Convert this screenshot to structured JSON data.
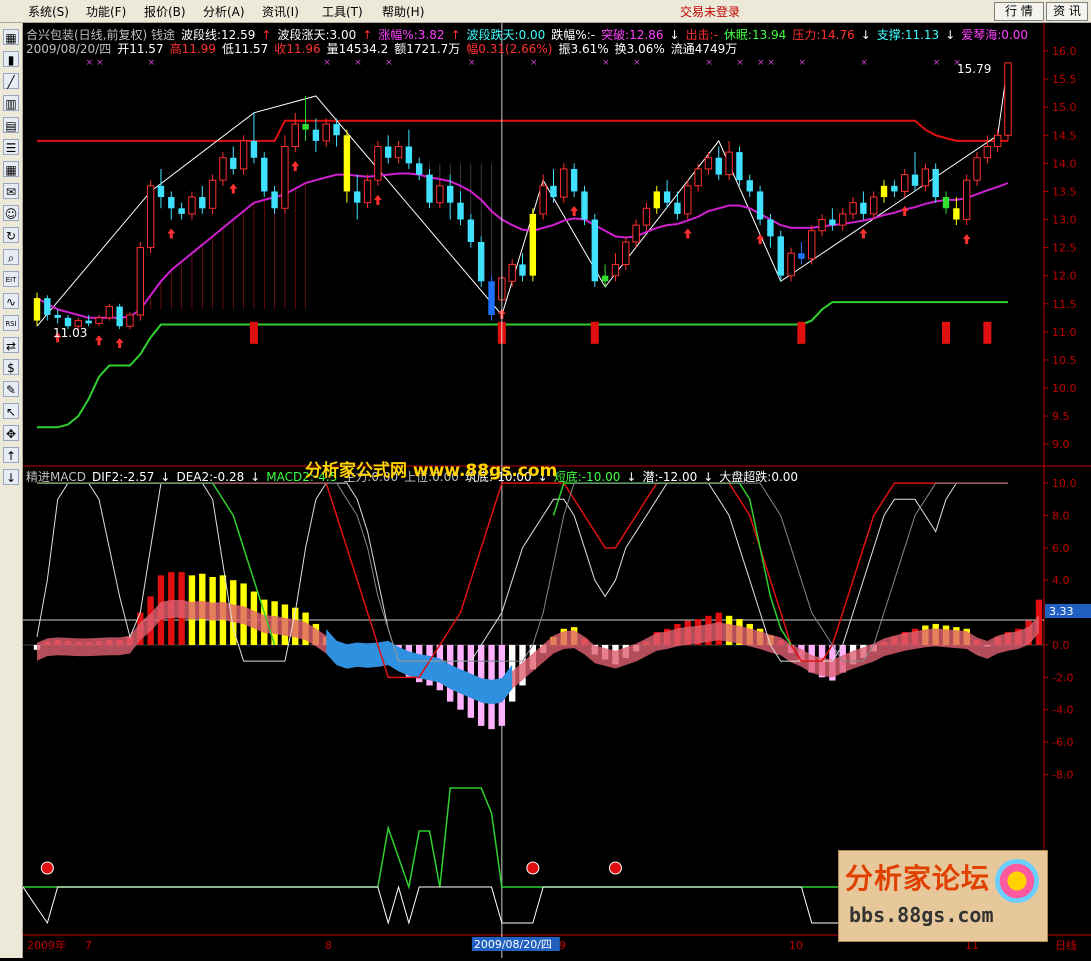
{
  "menu": {
    "items": [
      {
        "label": "系统(S)"
      },
      {
        "label": "功能(F)"
      },
      {
        "label": "报价(B)"
      },
      {
        "label": "分析(A)"
      },
      {
        "label": "资讯(I)"
      },
      {
        "label": "工具(T)"
      },
      {
        "label": "帮助(H)"
      }
    ],
    "status": "交易未登录",
    "quote_btn": "行 情",
    "info_btn": "资 讯"
  },
  "toolbar": {
    "icons": [
      "grid-icon",
      "candle-icon",
      "line-chart-icon",
      "bar-chart-icon",
      "window-icon",
      "list-icon",
      "table-icon",
      "mail-icon",
      "people-icon",
      "refresh-icon",
      "zoom-icon",
      "eft-icon",
      "wave-icon",
      "rsi-icon",
      "link-icon",
      "money-icon",
      "draw-icon",
      "pointer-icon",
      "move-icon",
      "arrow-up-icon",
      "arrow-down-icon"
    ],
    "labels": [
      "▦",
      "▮",
      "╱",
      "▥",
      "▤",
      "☰",
      "▦",
      "✉",
      "☺",
      "↻",
      "⌕",
      "EIT",
      "∿",
      "RSI",
      "⇄",
      "$",
      "✎",
      "↖",
      "✥",
      "↑",
      "↓"
    ]
  },
  "header": {
    "line1": [
      {
        "text": "合兴包装(日线,前复权) 钱途",
        "color": "#c0c0c0"
      },
      {
        "text": "波段线:12.59",
        "color": "#ffffff"
      },
      {
        "text": "↑",
        "color": "#ff3030"
      },
      {
        "text": "波段涨天:3.00",
        "color": "#ffffff"
      },
      {
        "text": "↑",
        "color": "#ff3030"
      },
      {
        "text": "涨幅%:3.82",
        "color": "#ff40ff"
      },
      {
        "text": "↑",
        "color": "#ff3030"
      },
      {
        "text": "波段跌天:0.00",
        "color": "#40ffff"
      },
      {
        "text": "跌幅%:-",
        "color": "#ffffff"
      },
      {
        "text": "突破:12.86",
        "color": "#ff40ff"
      },
      {
        "text": "↓",
        "color": "#ffffff"
      },
      {
        "text": "出击:-",
        "color": "#ff3030"
      },
      {
        "text": "休眠:13.94",
        "color": "#40ff40"
      },
      {
        "text": "压力:14.76",
        "color": "#ff3030"
      },
      {
        "text": "↓",
        "color": "#ffffff"
      },
      {
        "text": "支撑:11.13",
        "color": "#40ffff"
      },
      {
        "text": "↓",
        "color": "#ffffff"
      },
      {
        "text": "爱琴海:0.00",
        "color": "#ff40ff"
      }
    ],
    "line2": [
      {
        "text": "2009/08/20/四",
        "color": "#c0c0c0"
      },
      {
        "text": "开11.57",
        "color": "#ffffff"
      },
      {
        "text": "高11.99",
        "color": "#ff3030"
      },
      {
        "text": "低11.57",
        "color": "#ffffff"
      },
      {
        "text": "收11.96",
        "color": "#ff3030"
      },
      {
        "text": "量14534.2",
        "color": "#ffffff"
      },
      {
        "text": "额1721.7万",
        "color": "#ffffff"
      },
      {
        "text": "幅0.31(2.66%)",
        "color": "#ff3030"
      },
      {
        "text": "振3.61%",
        "color": "#ffffff"
      },
      {
        "text": "换3.06%",
        "color": "#ffffff"
      },
      {
        "text": "流通4749万",
        "color": "#ffffff"
      }
    ],
    "sub": [
      {
        "text": "精进MACD",
        "color": "#c0c0c0"
      },
      {
        "text": "DIF2:-2.57",
        "color": "#ffffff"
      },
      {
        "text": "↓",
        "color": "#ffffff"
      },
      {
        "text": "DEA2:-0.28",
        "color": "#ffffff"
      },
      {
        "text": "↓",
        "color": "#ffffff"
      },
      {
        "text": "MACD2:-4.5",
        "color": "#40ff40"
      },
      {
        "text": "主力:0.00",
        "color": "#c0c0c0"
      },
      {
        "text": "上位:0.00",
        "color": "#c0c0c0"
      },
      {
        "text": "筑底:-10.00",
        "color": "#ffffff"
      },
      {
        "text": "↓",
        "color": "#ffffff"
      },
      {
        "text": "短底:-10.00",
        "color": "#40ff40"
      },
      {
        "text": "↓",
        "color": "#ffffff"
      },
      {
        "text": "潜:-12.00",
        "color": "#ffffff"
      },
      {
        "text": "↓",
        "color": "#ffffff"
      },
      {
        "text": "大盘超跌:0.00",
        "color": "#ffffff"
      }
    ]
  },
  "watermark": "分析家公式网 www.88gs.com",
  "forum": {
    "title": "分析家论坛",
    "url": "bbs.88gs.com"
  },
  "price_labels": {
    "high": "15.79",
    "low": "11.03"
  },
  "crosshair_value": "3.33",
  "bottom_axis": {
    "year": "2009年",
    "m7": "7",
    "m8": "8",
    "cursor_date": "2009/08/20/四",
    "m9": "9",
    "m10": "10",
    "m11": "11",
    "period": "日线"
  },
  "chart_data": {
    "type": "candlestick",
    "price_axis": {
      "ticks": [
        16.0,
        15.5,
        15.0,
        14.5,
        14.0,
        13.5,
        13.0,
        12.5,
        12.0,
        11.5,
        11.0,
        10.5,
        10.0,
        9.5,
        9.0
      ],
      "min": 8.7,
      "max": 16.25
    },
    "macd_axis": {
      "ticks": [
        10.0,
        8.0,
        6.0,
        4.0,
        2.0,
        0.0,
        -2.0,
        -4.0,
        -6.0,
        -8.0
      ],
      "min": -11,
      "max": 10.5
    },
    "candles": [
      {
        "o": 11.2,
        "c": 11.6,
        "h": 11.7,
        "l": 11.1
      },
      {
        "o": 11.6,
        "c": 11.3,
        "h": 11.65,
        "l": 11.2
      },
      {
        "o": 11.3,
        "c": 11.25,
        "h": 11.4,
        "l": 11.15
      },
      {
        "o": 11.25,
        "c": 11.1,
        "h": 11.3,
        "l": 11.05
      },
      {
        "o": 11.1,
        "c": 11.2,
        "h": 11.25,
        "l": 11.03
      },
      {
        "o": 11.2,
        "c": 11.15,
        "h": 11.3,
        "l": 11.1
      },
      {
        "o": 11.15,
        "c": 11.25,
        "h": 11.3,
        "l": 11.1
      },
      {
        "o": 11.25,
        "c": 11.45,
        "h": 11.5,
        "l": 11.2
      },
      {
        "o": 11.45,
        "c": 11.1,
        "h": 11.5,
        "l": 11.05
      },
      {
        "o": 11.1,
        "c": 11.3,
        "h": 11.35,
        "l": 11.05
      },
      {
        "o": 11.3,
        "c": 12.5,
        "h": 12.6,
        "l": 11.2
      },
      {
        "o": 12.5,
        "c": 13.6,
        "h": 13.7,
        "l": 12.4
      },
      {
        "o": 13.6,
        "c": 13.4,
        "h": 13.9,
        "l": 13.2
      },
      {
        "o": 13.4,
        "c": 13.2,
        "h": 13.5,
        "l": 13.0
      },
      {
        "o": 13.2,
        "c": 13.1,
        "h": 13.3,
        "l": 13.0
      },
      {
        "o": 13.1,
        "c": 13.4,
        "h": 13.5,
        "l": 13.0
      },
      {
        "o": 13.4,
        "c": 13.2,
        "h": 13.6,
        "l": 13.1
      },
      {
        "o": 13.2,
        "c": 13.7,
        "h": 13.8,
        "l": 13.1
      },
      {
        "o": 13.7,
        "c": 14.1,
        "h": 14.2,
        "l": 13.6
      },
      {
        "o": 14.1,
        "c": 13.9,
        "h": 14.3,
        "l": 13.8
      },
      {
        "o": 13.9,
        "c": 14.4,
        "h": 14.5,
        "l": 13.8
      },
      {
        "o": 14.4,
        "c": 14.1,
        "h": 14.9,
        "l": 14.0
      },
      {
        "o": 14.1,
        "c": 13.5,
        "h": 14.2,
        "l": 13.4
      },
      {
        "o": 13.5,
        "c": 13.2,
        "h": 13.6,
        "l": 13.1
      },
      {
        "o": 13.2,
        "c": 14.3,
        "h": 14.5,
        "l": 13.1
      },
      {
        "o": 14.3,
        "c": 14.7,
        "h": 14.9,
        "l": 14.2
      },
      {
        "o": 14.7,
        "c": 14.6,
        "h": 15.2,
        "l": 14.4
      },
      {
        "o": 14.6,
        "c": 14.4,
        "h": 14.8,
        "l": 14.2
      },
      {
        "o": 14.4,
        "c": 14.7,
        "h": 14.8,
        "l": 14.3
      },
      {
        "o": 14.7,
        "c": 14.5,
        "h": 14.8,
        "l": 14.3
      },
      {
        "o": 14.5,
        "c": 13.5,
        "h": 14.6,
        "l": 13.3
      },
      {
        "o": 13.5,
        "c": 13.3,
        "h": 13.8,
        "l": 13.0
      },
      {
        "o": 13.3,
        "c": 13.7,
        "h": 13.8,
        "l": 13.2
      },
      {
        "o": 13.7,
        "c": 14.3,
        "h": 14.4,
        "l": 13.6
      },
      {
        "o": 14.3,
        "c": 14.1,
        "h": 14.5,
        "l": 14.0
      },
      {
        "o": 14.1,
        "c": 14.3,
        "h": 14.4,
        "l": 14.0
      },
      {
        "o": 14.3,
        "c": 14.0,
        "h": 14.6,
        "l": 13.9
      },
      {
        "o": 14.0,
        "c": 13.8,
        "h": 14.1,
        "l": 13.7
      },
      {
        "o": 13.8,
        "c": 13.3,
        "h": 13.9,
        "l": 13.2
      },
      {
        "o": 13.3,
        "c": 13.6,
        "h": 13.7,
        "l": 13.2
      },
      {
        "o": 13.6,
        "c": 13.3,
        "h": 13.8,
        "l": 13.0
      },
      {
        "o": 13.3,
        "c": 13.0,
        "h": 13.5,
        "l": 12.9
      },
      {
        "o": 13.0,
        "c": 12.6,
        "h": 13.1,
        "l": 12.5
      },
      {
        "o": 12.6,
        "c": 11.9,
        "h": 12.7,
        "l": 11.8
      },
      {
        "o": 11.9,
        "c": 11.3,
        "h": 12.0,
        "l": 11.2
      },
      {
        "o": 11.57,
        "c": 11.96,
        "h": 11.99,
        "l": 11.57
      },
      {
        "o": 11.9,
        "c": 12.2,
        "h": 12.3,
        "l": 11.8
      },
      {
        "o": 12.2,
        "c": 12.0,
        "h": 12.4,
        "l": 11.9
      },
      {
        "o": 12.0,
        "c": 13.1,
        "h": 13.2,
        "l": 11.9
      },
      {
        "o": 13.1,
        "c": 13.6,
        "h": 13.8,
        "l": 13.0
      },
      {
        "o": 13.6,
        "c": 13.4,
        "h": 13.9,
        "l": 13.3
      },
      {
        "o": 13.4,
        "c": 13.9,
        "h": 14.0,
        "l": 13.3
      },
      {
        "o": 13.9,
        "c": 13.5,
        "h": 14.0,
        "l": 13.4
      },
      {
        "o": 13.5,
        "c": 13.0,
        "h": 13.6,
        "l": 12.9
      },
      {
        "o": 13.0,
        "c": 11.9,
        "h": 13.1,
        "l": 11.8
      },
      {
        "o": 11.9,
        "c": 12.0,
        "h": 12.2,
        "l": 11.8
      },
      {
        "o": 12.0,
        "c": 12.2,
        "h": 12.4,
        "l": 11.9
      },
      {
        "o": 12.2,
        "c": 12.6,
        "h": 12.7,
        "l": 12.1
      },
      {
        "o": 12.6,
        "c": 12.9,
        "h": 13.0,
        "l": 12.5
      },
      {
        "o": 12.9,
        "c": 13.2,
        "h": 13.3,
        "l": 12.8
      },
      {
        "o": 13.2,
        "c": 13.5,
        "h": 13.6,
        "l": 13.1
      },
      {
        "o": 13.5,
        "c": 13.3,
        "h": 13.7,
        "l": 13.2
      },
      {
        "o": 13.3,
        "c": 13.1,
        "h": 13.5,
        "l": 13.0
      },
      {
        "o": 13.1,
        "c": 13.6,
        "h": 13.7,
        "l": 13.0
      },
      {
        "o": 13.6,
        "c": 13.9,
        "h": 14.0,
        "l": 13.5
      },
      {
        "o": 13.9,
        "c": 14.1,
        "h": 14.2,
        "l": 13.8
      },
      {
        "o": 14.1,
        "c": 13.8,
        "h": 14.3,
        "l": 13.7
      },
      {
        "o": 13.8,
        "c": 14.2,
        "h": 14.4,
        "l": 13.7
      },
      {
        "o": 14.2,
        "c": 13.7,
        "h": 14.3,
        "l": 13.6
      },
      {
        "o": 13.7,
        "c": 13.5,
        "h": 13.8,
        "l": 13.4
      },
      {
        "o": 13.5,
        "c": 13.0,
        "h": 13.6,
        "l": 12.9
      },
      {
        "o": 13.0,
        "c": 12.7,
        "h": 13.1,
        "l": 12.5
      },
      {
        "o": 12.7,
        "c": 12.0,
        "h": 12.8,
        "l": 11.9
      },
      {
        "o": 12.0,
        "c": 12.4,
        "h": 12.5,
        "l": 11.9
      },
      {
        "o": 12.4,
        "c": 12.3,
        "h": 12.6,
        "l": 12.2
      },
      {
        "o": 12.3,
        "c": 12.8,
        "h": 12.9,
        "l": 12.2
      },
      {
        "o": 12.8,
        "c": 13.0,
        "h": 13.1,
        "l": 12.7
      },
      {
        "o": 13.0,
        "c": 12.9,
        "h": 13.2,
        "l": 12.8
      },
      {
        "o": 12.9,
        "c": 13.1,
        "h": 13.2,
        "l": 12.8
      },
      {
        "o": 13.1,
        "c": 13.3,
        "h": 13.4,
        "l": 13.0
      },
      {
        "o": 13.3,
        "c": 13.1,
        "h": 13.5,
        "l": 13.0
      },
      {
        "o": 13.1,
        "c": 13.4,
        "h": 13.5,
        "l": 13.0
      },
      {
        "o": 13.4,
        "c": 13.6,
        "h": 13.7,
        "l": 13.3
      },
      {
        "o": 13.6,
        "c": 13.5,
        "h": 13.7,
        "l": 13.4
      },
      {
        "o": 13.5,
        "c": 13.8,
        "h": 13.9,
        "l": 13.4
      },
      {
        "o": 13.8,
        "c": 13.6,
        "h": 14.2,
        "l": 13.5
      },
      {
        "o": 13.6,
        "c": 13.9,
        "h": 14.0,
        "l": 13.5
      },
      {
        "o": 13.9,
        "c": 13.4,
        "h": 14.0,
        "l": 13.3
      },
      {
        "o": 13.4,
        "c": 13.2,
        "h": 13.5,
        "l": 13.1
      },
      {
        "o": 13.2,
        "c": 13.0,
        "h": 13.4,
        "l": 12.9
      },
      {
        "o": 13.0,
        "c": 13.7,
        "h": 13.8,
        "l": 12.9
      },
      {
        "o": 13.7,
        "c": 14.1,
        "h": 14.2,
        "l": 13.6
      },
      {
        "o": 14.1,
        "c": 14.3,
        "h": 14.5,
        "l": 14.0
      },
      {
        "o": 14.3,
        "c": 14.5,
        "h": 14.6,
        "l": 14.2
      },
      {
        "o": 14.5,
        "c": 15.79,
        "h": 15.79,
        "l": 14.4
      }
    ],
    "ma": [
      11.6,
      11.5,
      11.4,
      11.35,
      11.3,
      11.25,
      11.25,
      11.25,
      11.25,
      11.27,
      11.4,
      11.65,
      11.9,
      12.1,
      12.25,
      12.4,
      12.55,
      12.7,
      12.85,
      13.0,
      13.15,
      13.3,
      13.35,
      13.4,
      13.45,
      13.55,
      13.65,
      13.7,
      13.75,
      13.8,
      13.8,
      13.78,
      13.76,
      13.78,
      13.8,
      13.82,
      13.82,
      13.8,
      13.75,
      13.72,
      13.68,
      13.6,
      13.5,
      13.35,
      13.15,
      13.0,
      12.9,
      12.82,
      12.8,
      12.85,
      12.9,
      12.98,
      13.02,
      13.0,
      12.9,
      12.8,
      12.7,
      12.68,
      12.7,
      12.78,
      12.85,
      12.9,
      12.92,
      12.98,
      13.05,
      13.15,
      13.2,
      13.25,
      13.25,
      13.2,
      13.1,
      13.0,
      12.9,
      12.85,
      12.85,
      12.85,
      12.88,
      12.9,
      12.92,
      12.95,
      12.98,
      13.02,
      13.08,
      13.12,
      13.18,
      13.22,
      13.28,
      13.32,
      13.35,
      13.35,
      13.38,
      13.45,
      13.52,
      13.58,
      13.65
    ],
    "resistance": [
      14.4,
      14.4,
      14.4,
      14.4,
      14.4,
      14.4,
      14.4,
      14.4,
      14.4,
      14.4,
      14.4,
      14.4,
      14.4,
      14.4,
      14.4,
      14.4,
      14.4,
      14.4,
      14.4,
      14.4,
      14.4,
      14.4,
      14.4,
      14.4,
      14.76,
      14.76,
      14.76,
      14.76,
      14.76,
      14.76,
      14.76,
      14.76,
      14.76,
      14.76,
      14.76,
      14.76,
      14.76,
      14.76,
      14.76,
      14.76,
      14.76,
      14.76,
      14.76,
      14.76,
      14.76,
      14.76,
      14.76,
      14.76,
      14.76,
      14.76,
      14.76,
      14.76,
      14.76,
      14.76,
      14.76,
      14.76,
      14.76,
      14.76,
      14.76,
      14.76,
      14.76,
      14.76,
      14.76,
      14.76,
      14.76,
      14.76,
      14.76,
      14.76,
      14.76,
      14.76,
      14.76,
      14.76,
      14.76,
      14.76,
      14.76,
      14.76,
      14.76,
      14.76,
      14.76,
      14.76,
      14.76,
      14.76,
      14.76,
      14.76,
      14.76,
      14.76,
      14.6,
      14.5,
      14.45,
      14.4,
      14.4,
      14.4,
      14.4,
      14.4,
      14.4
    ],
    "support": [
      9.3,
      9.3,
      9.3,
      9.35,
      9.5,
      9.8,
      10.2,
      10.4,
      10.4,
      10.4,
      10.6,
      10.9,
      11.13,
      11.13,
      11.13,
      11.13,
      11.13,
      11.13,
      11.13,
      11.13,
      11.13,
      11.13,
      11.13,
      11.13,
      11.13,
      11.13,
      11.13,
      11.13,
      11.13,
      11.13,
      11.13,
      11.13,
      11.13,
      11.13,
      11.13,
      11.13,
      11.13,
      11.13,
      11.13,
      11.13,
      11.13,
      11.13,
      11.13,
      11.13,
      11.13,
      11.13,
      11.13,
      11.13,
      11.13,
      11.13,
      11.13,
      11.13,
      11.13,
      11.13,
      11.13,
      11.13,
      11.13,
      11.13,
      11.13,
      11.13,
      11.13,
      11.13,
      11.13,
      11.13,
      11.13,
      11.13,
      11.13,
      11.13,
      11.13,
      11.13,
      11.13,
      11.13,
      11.13,
      11.13,
      11.13,
      11.2,
      11.4,
      11.53,
      11.53,
      11.53,
      11.53,
      11.53,
      11.53,
      11.53,
      11.53,
      11.53,
      11.53,
      11.53,
      11.53,
      11.53,
      11.53,
      11.53,
      11.53,
      11.53,
      11.53
    ],
    "macd_hist": [
      -0.3,
      0.2,
      0.3,
      0.25,
      0.2,
      0.2,
      0.25,
      0.3,
      0.3,
      0.5,
      2.0,
      3.0,
      4.3,
      4.5,
      4.5,
      4.3,
      4.4,
      4.2,
      4.3,
      4.0,
      3.8,
      3.3,
      2.8,
      2.7,
      2.5,
      2.3,
      2.0,
      1.3,
      0.5,
      -0.8,
      -1.2,
      -1.0,
      -1.1,
      -1.0,
      -0.8,
      -1.5,
      -2.0,
      -2.3,
      -2.5,
      -2.8,
      -3.5,
      -4.0,
      -4.5,
      -5.0,
      -5.2,
      -5.0,
      -3.5,
      -2.5,
      -1.5,
      -0.5,
      0.5,
      1.0,
      1.1,
      0.4,
      -0.6,
      -0.9,
      -1.2,
      -0.8,
      -0.4,
      0.2,
      0.8,
      1.0,
      1.3,
      1.5,
      1.6,
      1.8,
      2.0,
      1.8,
      1.6,
      1.3,
      1.0,
      0.6,
      0.3,
      -0.5,
      -1.0,
      -1.7,
      -2.0,
      -2.2,
      -1.7,
      -1.2,
      -0.8,
      -0.4,
      0.2,
      0.5,
      0.8,
      1.0,
      1.2,
      1.3,
      1.2,
      1.1,
      1.0,
      0.3,
      -0.1,
      0.5,
      0.8,
      1.0,
      1.5,
      2.8
    ]
  }
}
